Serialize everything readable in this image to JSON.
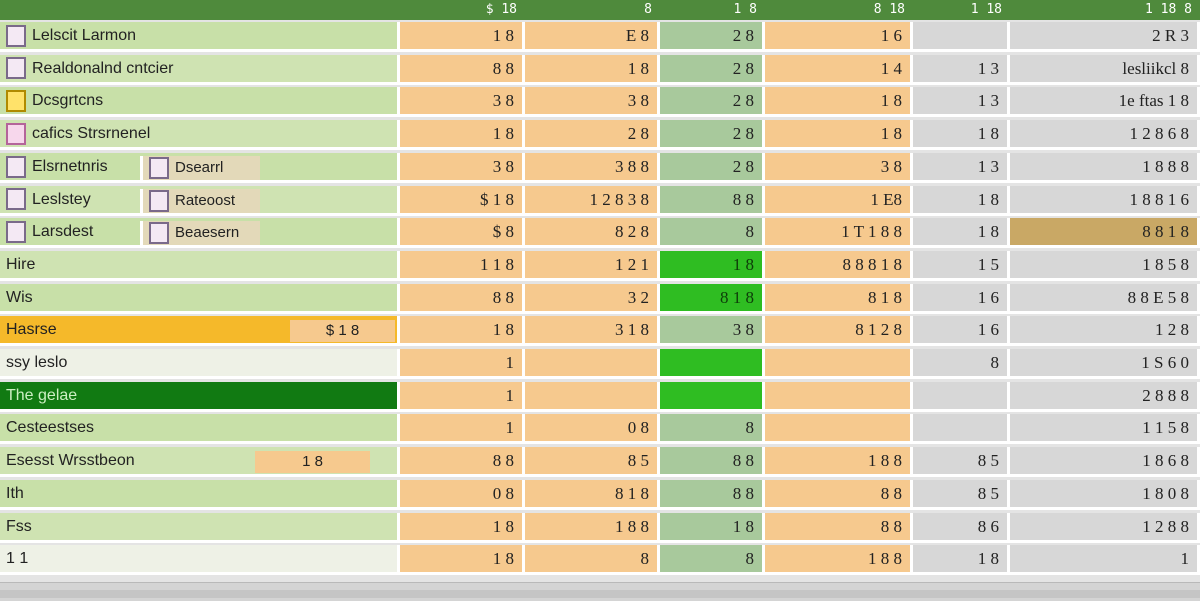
{
  "header": {
    "columns": [
      "",
      "$ 18",
      "8",
      "1 8",
      "8 18",
      "1 18",
      "1 18 8"
    ]
  },
  "rows": [
    {
      "label": "Lelscit Larmon",
      "icon": "checkbox",
      "a": "1 8",
      "b": "E 8",
      "c": "2 8",
      "d": "1 6",
      "e": "",
      "f": "2 R 3"
    },
    {
      "label": "Realdonalnd cntcier",
      "icon": "pencil-icon",
      "a": "8 8",
      "b": "1 8",
      "c": "2 8",
      "d": "1 4",
      "e": "1 3",
      "f": "lesliikcl 8"
    },
    {
      "label": "Dcsgrtcns",
      "icon": "warning-checkbox",
      "a": "3 8",
      "b": "3 8",
      "c": "2 8",
      "d": "1 8",
      "e": "1 3",
      "f": "1e ftas 1 8"
    },
    {
      "label": "cafics Strsrnenel",
      "icon": "pink-checkbox",
      "a": "1 8",
      "b": "2 8",
      "c": "2 8",
      "d": "1 8",
      "e": "1 8",
      "f": "1 2 8 6 8"
    },
    {
      "label": "Elsrnetnris",
      "icon": "checkbox",
      "sub": "Dsearrl",
      "a": "3 8",
      "b": "3 8 8",
      "c": "2 8",
      "d": "3 8",
      "e": "1 3",
      "f": "1 8 8 8"
    },
    {
      "label": "Leslstey",
      "icon": "checkbox",
      "sub": "Rateoost",
      "a": "$ 1 8",
      "b": "1 2 8 3 8",
      "c": "8 8",
      "d": "1 E8",
      "e": "1 8",
      "f": "1 8 8 1 6"
    },
    {
      "label": "Larsdest",
      "icon": "checkbox",
      "sub": "Beaesern",
      "a": "$ 8",
      "b": "8 2 8",
      "c": "8",
      "d": "1 T 1 8 8",
      "e": "1 8",
      "f": "8 8 1 8",
      "f_gold": true
    },
    {
      "label": "Hire",
      "a": "1 1 8",
      "b": "1 2 1",
      "c": "1 8",
      "c_style": "bright",
      "d": "8 8 8 1 8",
      "e": "1 5",
      "f": "1 8 5 8"
    },
    {
      "label": "Wis",
      "a": "8 8",
      "b": "3 2",
      "c": "8 1 8",
      "c_style": "bright",
      "d": "8 1 8",
      "e": "1 6",
      "f": "8 8 E 5 8"
    },
    {
      "label": "Hasrse",
      "label_style": "yellow",
      "tag": "$ 1 8",
      "a": "1 8",
      "b": "3 1 8",
      "c": "3 8",
      "d": "8 1 2 8",
      "e": "1 6",
      "f": "1 2 8"
    },
    {
      "label": "ssy leslo",
      "label_style": "pale",
      "a": "1",
      "b": "",
      "c": "",
      "c_style": "bright",
      "d": "",
      "e": "8",
      "f": "1 S 6 0"
    },
    {
      "label": "The gelae",
      "label_style": "dark",
      "a": "1",
      "b": "",
      "c": "",
      "c_style": "bright",
      "d": "",
      "e": "",
      "f": "2 8 8 8"
    },
    {
      "label": "Cesteestses",
      "a": "1",
      "b": "0 8",
      "c": "8",
      "d": "",
      "e": "",
      "f": "1 1 5 8"
    },
    {
      "label": "Esesst Wrsstbeon",
      "tag": "1 8",
      "a": "8 8",
      "b": "8 5",
      "c": "8 8",
      "d": "1 8 8",
      "e": "8 5",
      "f": "1 8 6 8"
    },
    {
      "label": "Ith",
      "a": "0 8",
      "b": "8 1 8",
      "c": "8 8",
      "d": "8 8",
      "e": "8 5",
      "f": "1 8 0 8"
    },
    {
      "label": "Fss",
      "a": "1 8",
      "b": "1 8 8",
      "c": "1 8",
      "d": "8 8",
      "e": "8 6",
      "f": "1 2 8 8"
    },
    {
      "label": "1 1",
      "label_style": "pale",
      "a": "1 8",
      "b": "8",
      "c": "8",
      "d": "1 8 8",
      "e": "1 8",
      "f": "1"
    }
  ],
  "colors": {
    "header": "#4f8a3c",
    "label_green": "#c8e0a8",
    "peach": "#f6c98e",
    "sage": "#a8c99c",
    "bright_green": "#2fbd22",
    "gray": "#d7d7d7",
    "gold": "#c9a865",
    "yellow": "#f5b92a",
    "dark_green": "#117a12"
  }
}
